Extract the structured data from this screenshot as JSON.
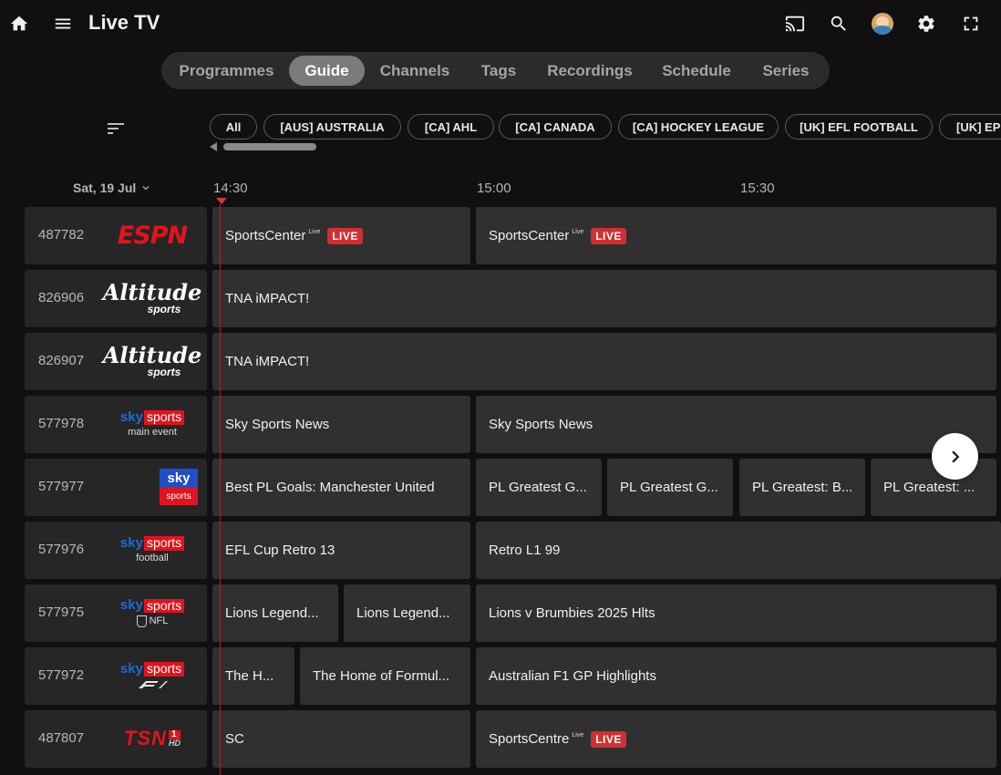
{
  "header": {
    "title": "Live TV",
    "icons": [
      "home-icon",
      "menu-icon",
      "cast-icon",
      "search-icon",
      "avatar",
      "settings-icon",
      "fullscreen-icon"
    ]
  },
  "tabs": [
    {
      "label": "Programmes",
      "active": false
    },
    {
      "label": "Guide",
      "active": true
    },
    {
      "label": "Channels",
      "active": false
    },
    {
      "label": "Tags",
      "active": false
    },
    {
      "label": "Recordings",
      "active": false
    },
    {
      "label": "Schedule",
      "active": false
    },
    {
      "label": "Series",
      "active": false
    }
  ],
  "tags": [
    "All",
    "[AUS] AUSTRALIA",
    "[CA] AHL",
    "[CA] CANADA",
    "[CA] HOCKEY LEAGUE",
    "[UK] EFL FOOTBALL",
    "[UK] EPL"
  ],
  "guide": {
    "date": "Sat, 19 Jul",
    "times": [
      "14:30",
      "15:00",
      "15:30"
    ]
  },
  "channels": [
    {
      "number": "487782",
      "logo": "ESPN",
      "programs": [
        {
          "title": "SportsCenter",
          "sup": "Live",
          "live": "LIVE"
        },
        {
          "title": "SportsCenter",
          "sup": "Live",
          "live": "LIVE"
        }
      ]
    },
    {
      "number": "826906",
      "logo": "Altitude",
      "logo_sub": "sports",
      "programs": [
        {
          "title": "TNA iMPACT!"
        }
      ]
    },
    {
      "number": "826907",
      "logo": "Altitude",
      "logo_sub": "sports",
      "programs": [
        {
          "title": "TNA iMPACT!"
        }
      ]
    },
    {
      "number": "577978",
      "logo": "sky",
      "logo_mid": "sports",
      "logo_sub": "main event",
      "programs": [
        {
          "title": "Sky Sports News"
        },
        {
          "title": "Sky Sports News"
        }
      ]
    },
    {
      "number": "577977",
      "logo": "sky",
      "logo_mid": "sports",
      "programs": [
        {
          "title": "Best PL Goals: Manchester United"
        },
        {
          "title": "PL Greatest G..."
        },
        {
          "title": "PL Greatest G..."
        },
        {
          "title": "PL Greatest: B..."
        },
        {
          "title": "PL Greatest: ..."
        }
      ]
    },
    {
      "number": "577976",
      "logo": "sky",
      "logo_mid": "sports",
      "logo_sub": "football",
      "programs": [
        {
          "title": "EFL Cup Retro 13"
        },
        {
          "title": "Retro L1 99"
        }
      ]
    },
    {
      "number": "577975",
      "logo": "sky",
      "logo_mid": "sports",
      "logo_sub": "NFL",
      "programs": [
        {
          "title": "Lions Legend..."
        },
        {
          "title": "Lions Legend..."
        },
        {
          "title": "Lions v Brumbies 2025 Hlts"
        }
      ]
    },
    {
      "number": "577972",
      "logo": "sky",
      "logo_mid": "sports",
      "programs": [
        {
          "title": "The H..."
        },
        {
          "title": "The Home of Formul..."
        },
        {
          "title": "Australian F1 GP Highlights"
        }
      ]
    },
    {
      "number": "487807",
      "logo": "TSN",
      "logo_mid": "1",
      "logo_sub": "HD",
      "programs": [
        {
          "title": "SC"
        },
        {
          "title": "SportsCentre",
          "sup": "Live",
          "live": "LIVE"
        }
      ]
    }
  ],
  "colors": {
    "live": "#d32f2f",
    "espn": "#e0141e",
    "sky_blue": "#1e6bd6",
    "sky_red": "#e0141e"
  }
}
